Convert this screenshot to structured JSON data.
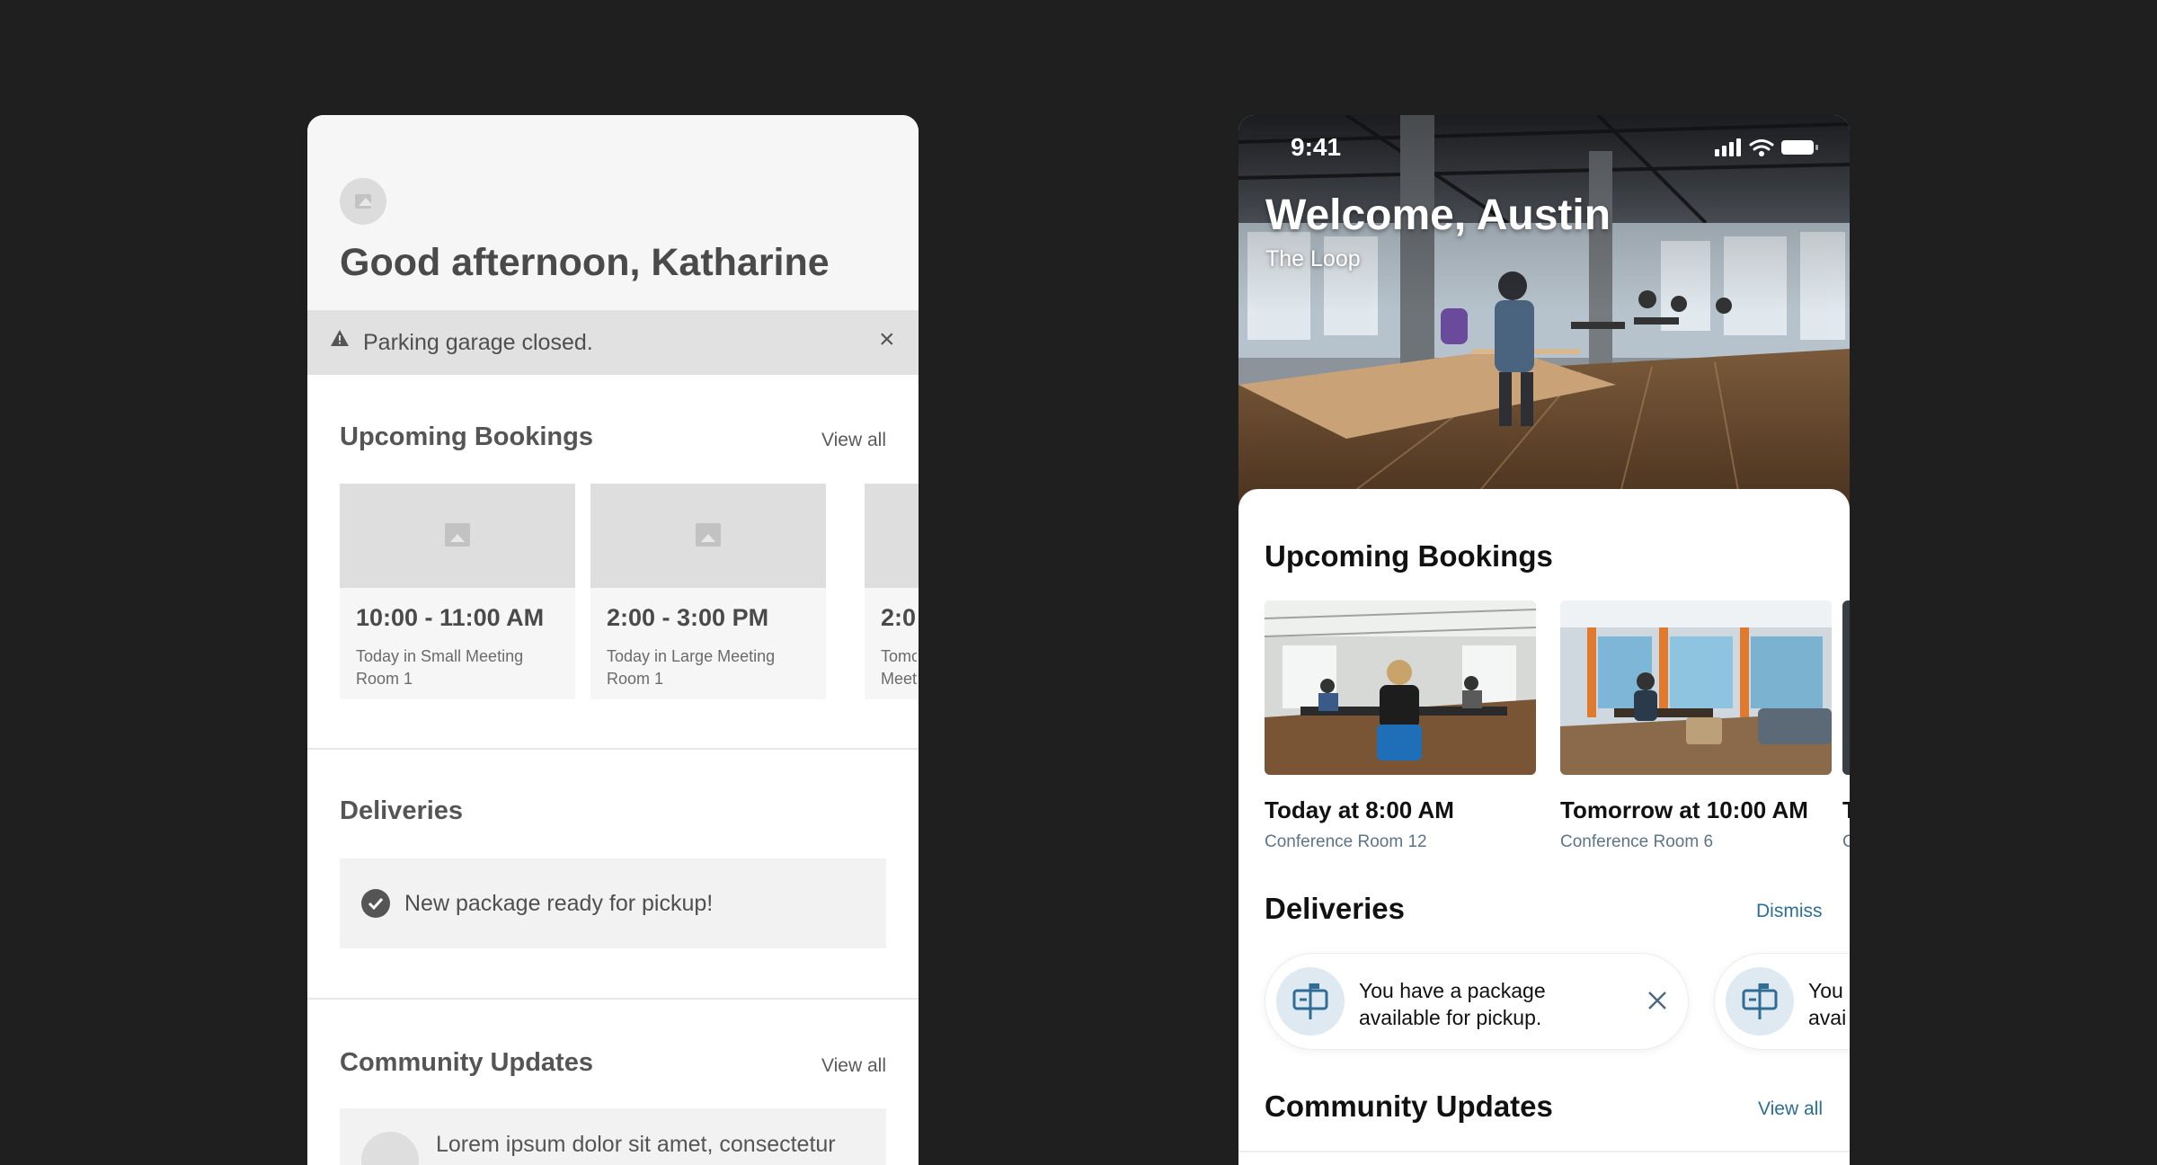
{
  "wireframe": {
    "greeting": "Good afternoon, Katharine",
    "alert": {
      "text": "Parking garage closed.",
      "close": "×"
    },
    "bookings": {
      "title": "Upcoming Bookings",
      "view_all": "View all",
      "cards": [
        {
          "time": "10:00 - 11:00 AM",
          "subtitle": "Today in Small Meeting Room 1"
        },
        {
          "time": "2:00 - 3:00 PM",
          "subtitle": "Today in Large Meeting Room 1"
        },
        {
          "time": "2:0",
          "subtitle": "Tomo Meet"
        }
      ]
    },
    "deliveries": {
      "title": "Deliveries",
      "message": "New package ready for pickup!"
    },
    "community": {
      "title": "Community Updates",
      "view_all": "View all",
      "preview": "Lorem ipsum dolor sit amet, consectetur"
    }
  },
  "phone": {
    "status_time": "9:41",
    "welcome": "Welcome, Austin",
    "location": "The Loop",
    "bookings": {
      "title": "Upcoming Bookings",
      "cards": [
        {
          "title": "Today at 8:00 AM",
          "subtitle": "Conference Room 12"
        },
        {
          "title": "Tomorrow at 10:00 AM",
          "subtitle": "Conference Room 6"
        },
        {
          "title": "T",
          "subtitle": "C"
        }
      ]
    },
    "deliveries": {
      "title": "Deliveries",
      "dismiss": "Dismiss",
      "cards": [
        {
          "line1": "You have a package",
          "line2": "available for pickup."
        },
        {
          "line1": "You",
          "line2": "avai"
        }
      ]
    },
    "community": {
      "title": "Community Updates",
      "view_all": "View all"
    }
  },
  "colors": {
    "link": "#2b6f94",
    "background": "#1f1f1f",
    "wire_gray": "#4a4a4a"
  },
  "icons": [
    "image-placeholder-icon",
    "warning-icon",
    "close-icon",
    "check-circle-icon",
    "signal-icon",
    "wifi-icon",
    "battery-icon",
    "mailbox-icon"
  ]
}
